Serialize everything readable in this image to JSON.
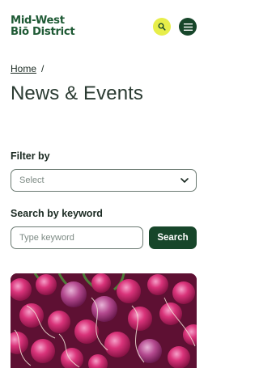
{
  "header": {
    "logo_line1": "Mid-West",
    "logo_line2": "Biō District",
    "search_icon": "search-icon",
    "menu_icon": "hamburger-menu-icon",
    "colors": {
      "brand": "#1f5a35",
      "accent": "#e7ee4a",
      "dark": "#17462a"
    }
  },
  "breadcrumb": {
    "home": "Home",
    "separator": "/"
  },
  "page": {
    "title": "News & Events"
  },
  "filter": {
    "label": "Filter by",
    "select_value": "Select",
    "chevron_icon": "chevron-down-icon"
  },
  "keyword": {
    "label": "Search by keyword",
    "placeholder": "Type keyword",
    "button_label": "Search"
  },
  "card": {
    "image": "radishes-photo"
  }
}
